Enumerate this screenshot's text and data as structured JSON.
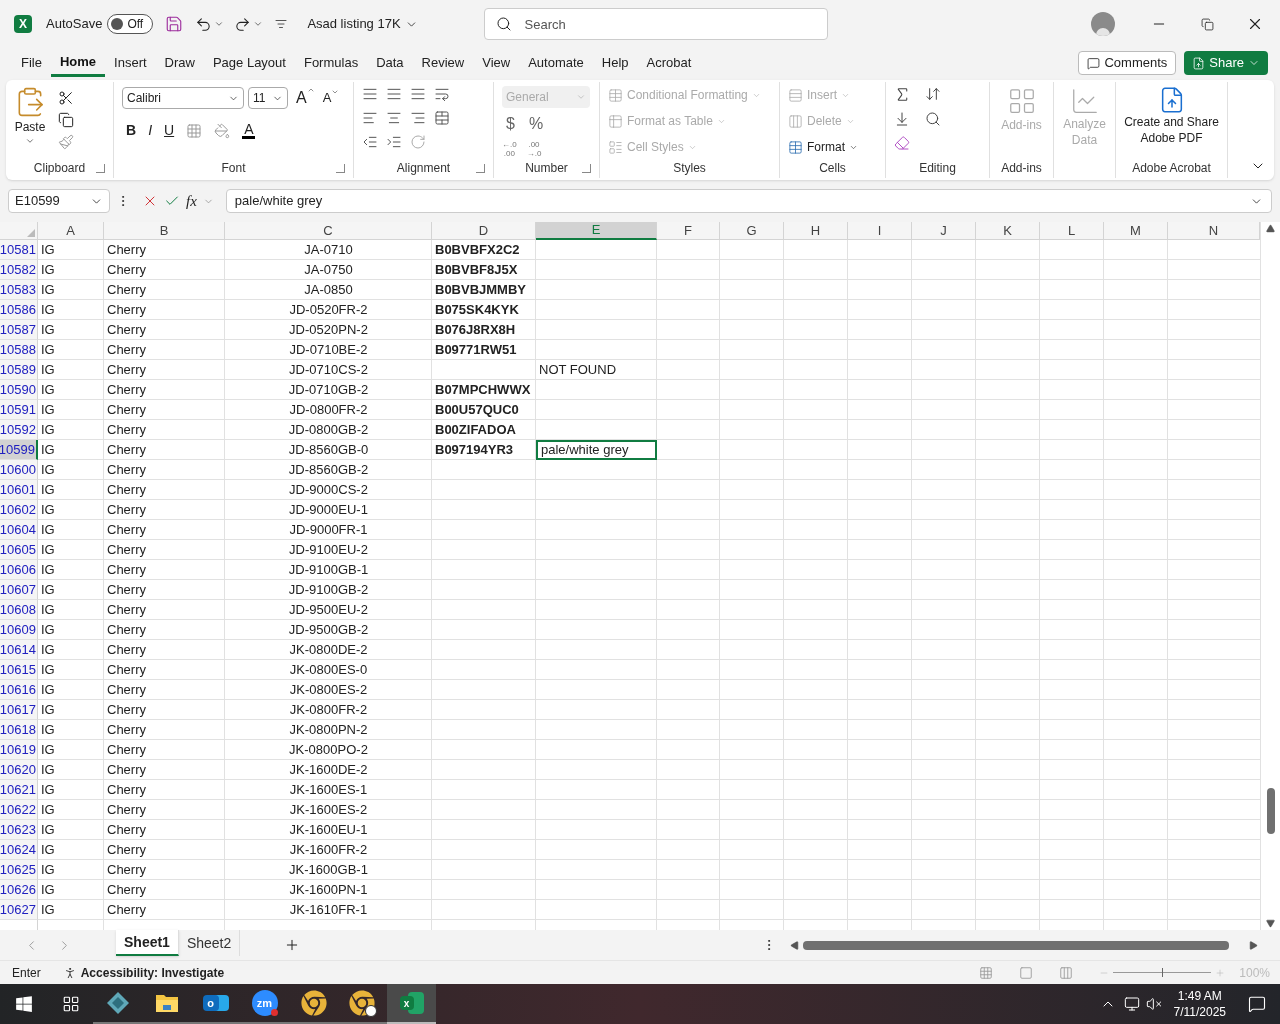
{
  "title_bar": {
    "app_glyph": "X",
    "autosave_label": "AutoSave",
    "autosave_state": "Off",
    "autosave_on": false,
    "document_title": "Asad listing 17K",
    "search_placeholder": "Search"
  },
  "ribbon_tabs": [
    {
      "label": "File",
      "selected": false
    },
    {
      "label": "Home",
      "selected": true
    },
    {
      "label": "Insert",
      "selected": false
    },
    {
      "label": "Draw",
      "selected": false
    },
    {
      "label": "Page Layout",
      "selected": false
    },
    {
      "label": "Formulas",
      "selected": false
    },
    {
      "label": "Data",
      "selected": false
    },
    {
      "label": "Review",
      "selected": false
    },
    {
      "label": "View",
      "selected": false
    },
    {
      "label": "Automate",
      "selected": false
    },
    {
      "label": "Help",
      "selected": false
    },
    {
      "label": "Acrobat",
      "selected": false
    }
  ],
  "comments_button": "Comments",
  "share_button": "Share",
  "clipboard": {
    "paste": "Paste",
    "label": "Clipboard"
  },
  "font": {
    "name": "Calibri",
    "size": "11",
    "grow": "A",
    "shrink": "A",
    "bold": "B",
    "italic": "I",
    "underline": "U",
    "color_glyph": "A",
    "label": "Font"
  },
  "alignment": {
    "label": "Alignment"
  },
  "number": {
    "format": "General",
    "format_disabled": true,
    "currency": "$",
    "percent": "%",
    "increase_decimal": [
      "←.0",
      ".00"
    ],
    "decrease_decimal": [
      ".00",
      "→.0"
    ],
    "label": "Number"
  },
  "styles": {
    "disabled": true,
    "items": [
      "Conditional Formatting",
      "Format as Table",
      "Cell Styles"
    ],
    "label": "Styles"
  },
  "cells": {
    "items": [
      {
        "label": "Insert",
        "disabled": true
      },
      {
        "label": "Delete",
        "disabled": true
      },
      {
        "label": "Format",
        "disabled": false
      }
    ],
    "label": "Cells"
  },
  "editing": {
    "label": "Editing"
  },
  "add_ins": {
    "button": "Add-ins",
    "disabled": true,
    "label": "Add-ins"
  },
  "analyze": {
    "button": [
      "Analyze",
      "Data"
    ],
    "disabled": true
  },
  "acrobat": {
    "button": [
      "Create and Share",
      "Adobe PDF"
    ],
    "label": "Adobe Acrobat"
  },
  "formula_bar": {
    "name_box": "E10599",
    "function_glyph": "fx",
    "formula": "pale/white grey"
  },
  "columns": [
    {
      "label": "A",
      "selected": false
    },
    {
      "label": "B",
      "selected": false
    },
    {
      "label": "C",
      "selected": false
    },
    {
      "label": "D",
      "selected": false
    },
    {
      "label": "E",
      "selected": true
    },
    {
      "label": "F",
      "selected": false
    },
    {
      "label": "G",
      "selected": false
    },
    {
      "label": "H",
      "selected": false
    },
    {
      "label": "I",
      "selected": false
    },
    {
      "label": "J",
      "selected": false
    },
    {
      "label": "K",
      "selected": false
    },
    {
      "label": "L",
      "selected": false
    },
    {
      "label": "M",
      "selected": false
    },
    {
      "label": "N",
      "selected": false
    }
  ],
  "rows": [
    {
      "row": "10581",
      "a": "IG",
      "b": "Cherry",
      "c": "JA-0710",
      "d": "B0BVBFX2C2",
      "selected": false
    },
    {
      "row": "10582",
      "a": "IG",
      "b": "Cherry",
      "c": "JA-0750",
      "d": "B0BVBF8J5X",
      "selected": false
    },
    {
      "row": "10583",
      "a": "IG",
      "b": "Cherry",
      "c": "JA-0850",
      "d": "B0BVBJMMBY",
      "selected": false
    },
    {
      "row": "10586",
      "a": "IG",
      "b": "Cherry",
      "c": "JD-0520FR-2",
      "d": "B075SK4KYK",
      "selected": false
    },
    {
      "row": "10587",
      "a": "IG",
      "b": "Cherry",
      "c": "JD-0520PN-2",
      "d": "B076J8RX8H",
      "selected": false
    },
    {
      "row": "10588",
      "a": "IG",
      "b": "Cherry",
      "c": "JD-0710BE-2",
      "d": "B09771RW51",
      "selected": false
    },
    {
      "row": "10589",
      "a": "IG",
      "b": "Cherry",
      "c": "JD-0710CS-2",
      "e": "NOT FOUND",
      "selected": false
    },
    {
      "row": "10590",
      "a": "IG",
      "b": "Cherry",
      "c": "JD-0710GB-2",
      "d": "B07MPCHWWX",
      "selected": false
    },
    {
      "row": "10591",
      "a": "IG",
      "b": "Cherry",
      "c": "JD-0800FR-2",
      "d": "B00U57QUC0",
      "selected": false
    },
    {
      "row": "10592",
      "a": "IG",
      "b": "Cherry",
      "c": "JD-0800GB-2",
      "d": "B00ZIFADOA",
      "selected": false
    },
    {
      "row": "10599",
      "a": "IG",
      "b": "Cherry",
      "c": "JD-8560GB-0",
      "d": "B097194YR3",
      "e": "pale/white grey",
      "selected": true
    },
    {
      "row": "10600",
      "a": "IG",
      "b": "Cherry",
      "c": "JD-8560GB-2",
      "selected": false
    },
    {
      "row": "10601",
      "a": "IG",
      "b": "Cherry",
      "c": "JD-9000CS-2",
      "selected": false
    },
    {
      "row": "10602",
      "a": "IG",
      "b": "Cherry",
      "c": "JD-9000EU-1",
      "selected": false
    },
    {
      "row": "10604",
      "a": "IG",
      "b": "Cherry",
      "c": "JD-9000FR-1",
      "selected": false
    },
    {
      "row": "10605",
      "a": "IG",
      "b": "Cherry",
      "c": "JD-9100EU-2",
      "selected": false
    },
    {
      "row": "10606",
      "a": "IG",
      "b": "Cherry",
      "c": "JD-9100GB-1",
      "selected": false
    },
    {
      "row": "10607",
      "a": "IG",
      "b": "Cherry",
      "c": "JD-9100GB-2",
      "selected": false
    },
    {
      "row": "10608",
      "a": "IG",
      "b": "Cherry",
      "c": "JD-9500EU-2",
      "selected": false
    },
    {
      "row": "10609",
      "a": "IG",
      "b": "Cherry",
      "c": "JD-9500GB-2",
      "selected": false
    },
    {
      "row": "10614",
      "a": "IG",
      "b": "Cherry",
      "c": "JK-0800DE-2",
      "selected": false
    },
    {
      "row": "10615",
      "a": "IG",
      "b": "Cherry",
      "c": "JK-0800ES-0",
      "selected": false
    },
    {
      "row": "10616",
      "a": "IG",
      "b": "Cherry",
      "c": "JK-0800ES-2",
      "selected": false
    },
    {
      "row": "10617",
      "a": "IG",
      "b": "Cherry",
      "c": "JK-0800FR-2",
      "selected": false
    },
    {
      "row": "10618",
      "a": "IG",
      "b": "Cherry",
      "c": "JK-0800PN-2",
      "selected": false
    },
    {
      "row": "10619",
      "a": "IG",
      "b": "Cherry",
      "c": "JK-0800PO-2",
      "selected": false
    },
    {
      "row": "10620",
      "a": "IG",
      "b": "Cherry",
      "c": "JK-1600DE-2",
      "selected": false
    },
    {
      "row": "10621",
      "a": "IG",
      "b": "Cherry",
      "c": "JK-1600ES-1",
      "selected": false
    },
    {
      "row": "10622",
      "a": "IG",
      "b": "Cherry",
      "c": "JK-1600ES-2",
      "selected": false
    },
    {
      "row": "10623",
      "a": "IG",
      "b": "Cherry",
      "c": "JK-1600EU-1",
      "selected": false
    },
    {
      "row": "10624",
      "a": "IG",
      "b": "Cherry",
      "c": "JK-1600FR-2",
      "selected": false
    },
    {
      "row": "10625",
      "a": "IG",
      "b": "Cherry",
      "c": "JK-1600GB-1",
      "selected": false
    },
    {
      "row": "10626",
      "a": "IG",
      "b": "Cherry",
      "c": "JK-1600PN-1",
      "selected": false
    },
    {
      "row": "10627",
      "a": "IG",
      "b": "Cherry",
      "c": "JK-1610FR-1",
      "selected": false
    }
  ],
  "sheet_tabs": [
    {
      "label": "Sheet1",
      "selected": true
    },
    {
      "label": "Sheet2",
      "selected": false
    }
  ],
  "status_bar": {
    "mode": "Enter",
    "accessibility": "Accessibility: Investigate",
    "zoom_slider": {
      "level": 0.5
    },
    "zoom": "100%"
  },
  "taskbar": {
    "apps": [
      {
        "kind": "diamond",
        "active": false
      },
      {
        "kind": "folder",
        "active": false
      },
      {
        "kind": "outlook",
        "glyph": "o",
        "active": false
      },
      {
        "kind": "zoom",
        "glyph": "zm",
        "active": false
      },
      {
        "kind": "chrome",
        "active": false
      },
      {
        "kind": "chrome_profile",
        "active": false
      },
      {
        "kind": "excel",
        "glyph": "x",
        "active": true
      }
    ],
    "time": "1:49 AM",
    "date": "7/11/2025"
  }
}
